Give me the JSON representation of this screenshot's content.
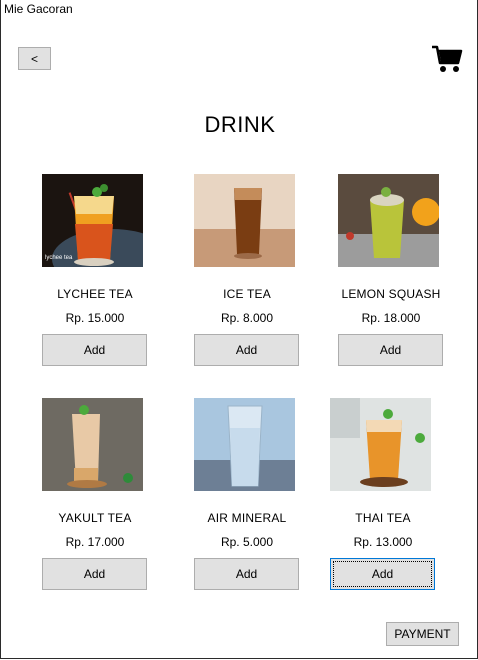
{
  "window": {
    "title": "Mie Gacoran"
  },
  "toolbar": {
    "back_label": "<",
    "cart_icon": "shopping-cart-icon"
  },
  "page": {
    "heading": "DRINK"
  },
  "products": [
    {
      "name": "LYCHEE TEA",
      "price": "Rp. 15.000",
      "add_label": "Add",
      "image_caption": "lychee tea"
    },
    {
      "name": "ICE TEA",
      "price": "Rp. 8.000",
      "add_label": "Add"
    },
    {
      "name": "LEMON SQUASH",
      "price": "Rp. 18.000",
      "add_label": "Add"
    },
    {
      "name": "YAKULT TEA",
      "price": "Rp. 17.000",
      "add_label": "Add"
    },
    {
      "name": "AIR MINERAL",
      "price": "Rp. 5.000",
      "add_label": "Add"
    },
    {
      "name": "THAI TEA",
      "price": "Rp. 13.000",
      "add_label": "Add"
    }
  ],
  "footer": {
    "payment_label": "PAYMENT"
  }
}
